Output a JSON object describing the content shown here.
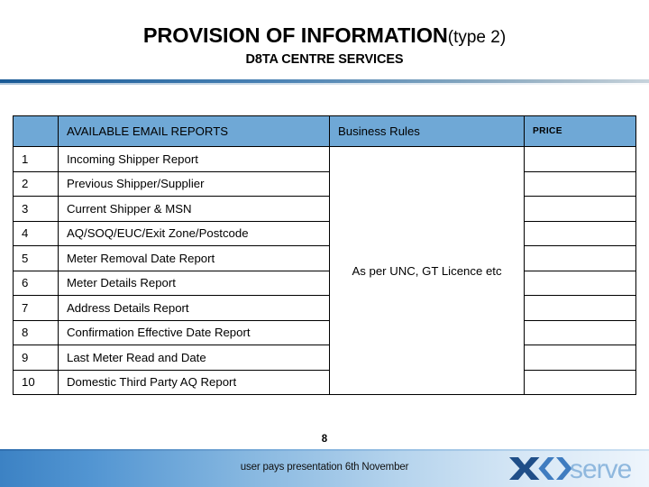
{
  "slide": {
    "title_main": "PROVISION OF INFORMATION",
    "title_paren": "(type 2)",
    "subtitle": "D8TA CENTRE SERVICES",
    "page_number": "8",
    "footer_text": "user pays presentation 6th November",
    "brand_name": "xoserve",
    "brand_mark_icon": "xoserve-diamond-icon"
  },
  "colors": {
    "header_blue": "#6fa8d6",
    "rule_dark_blue": "#1a5a96",
    "footer_blue": "#3c82c4",
    "logo_dark": "#1f4e88",
    "logo_mid": "#3f7cc0",
    "logo_light": "#8fb8de"
  },
  "table": {
    "columns": [
      {
        "key": "num",
        "label": ""
      },
      {
        "key": "name",
        "label": "AVAILABLE EMAIL REPORTS"
      },
      {
        "key": "rules",
        "label": "Business Rules"
      },
      {
        "key": "price",
        "label": "PRICE"
      }
    ],
    "business_rules_note": "As per UNC, GT Licence etc",
    "rows": [
      {
        "num": "1",
        "name": "Incoming Shipper Report",
        "price": ""
      },
      {
        "num": "2",
        "name": "Previous Shipper/Supplier",
        "price": ""
      },
      {
        "num": "3",
        "name": "Current Shipper & MSN",
        "price": ""
      },
      {
        "num": "4",
        "name": "AQ/SOQ/EUC/Exit Zone/Postcode",
        "price": ""
      },
      {
        "num": "5",
        "name": "Meter Removal Date Report",
        "price": ""
      },
      {
        "num": "6",
        "name": "Meter Details Report",
        "price": ""
      },
      {
        "num": "7",
        "name": "Address Details Report",
        "price": ""
      },
      {
        "num": "8",
        "name": "Confirmation Effective Date Report",
        "price": ""
      },
      {
        "num": "9",
        "name": "Last Meter Read and Date",
        "price": ""
      },
      {
        "num": "10",
        "name": "Domestic Third Party AQ Report",
        "price": ""
      }
    ]
  }
}
